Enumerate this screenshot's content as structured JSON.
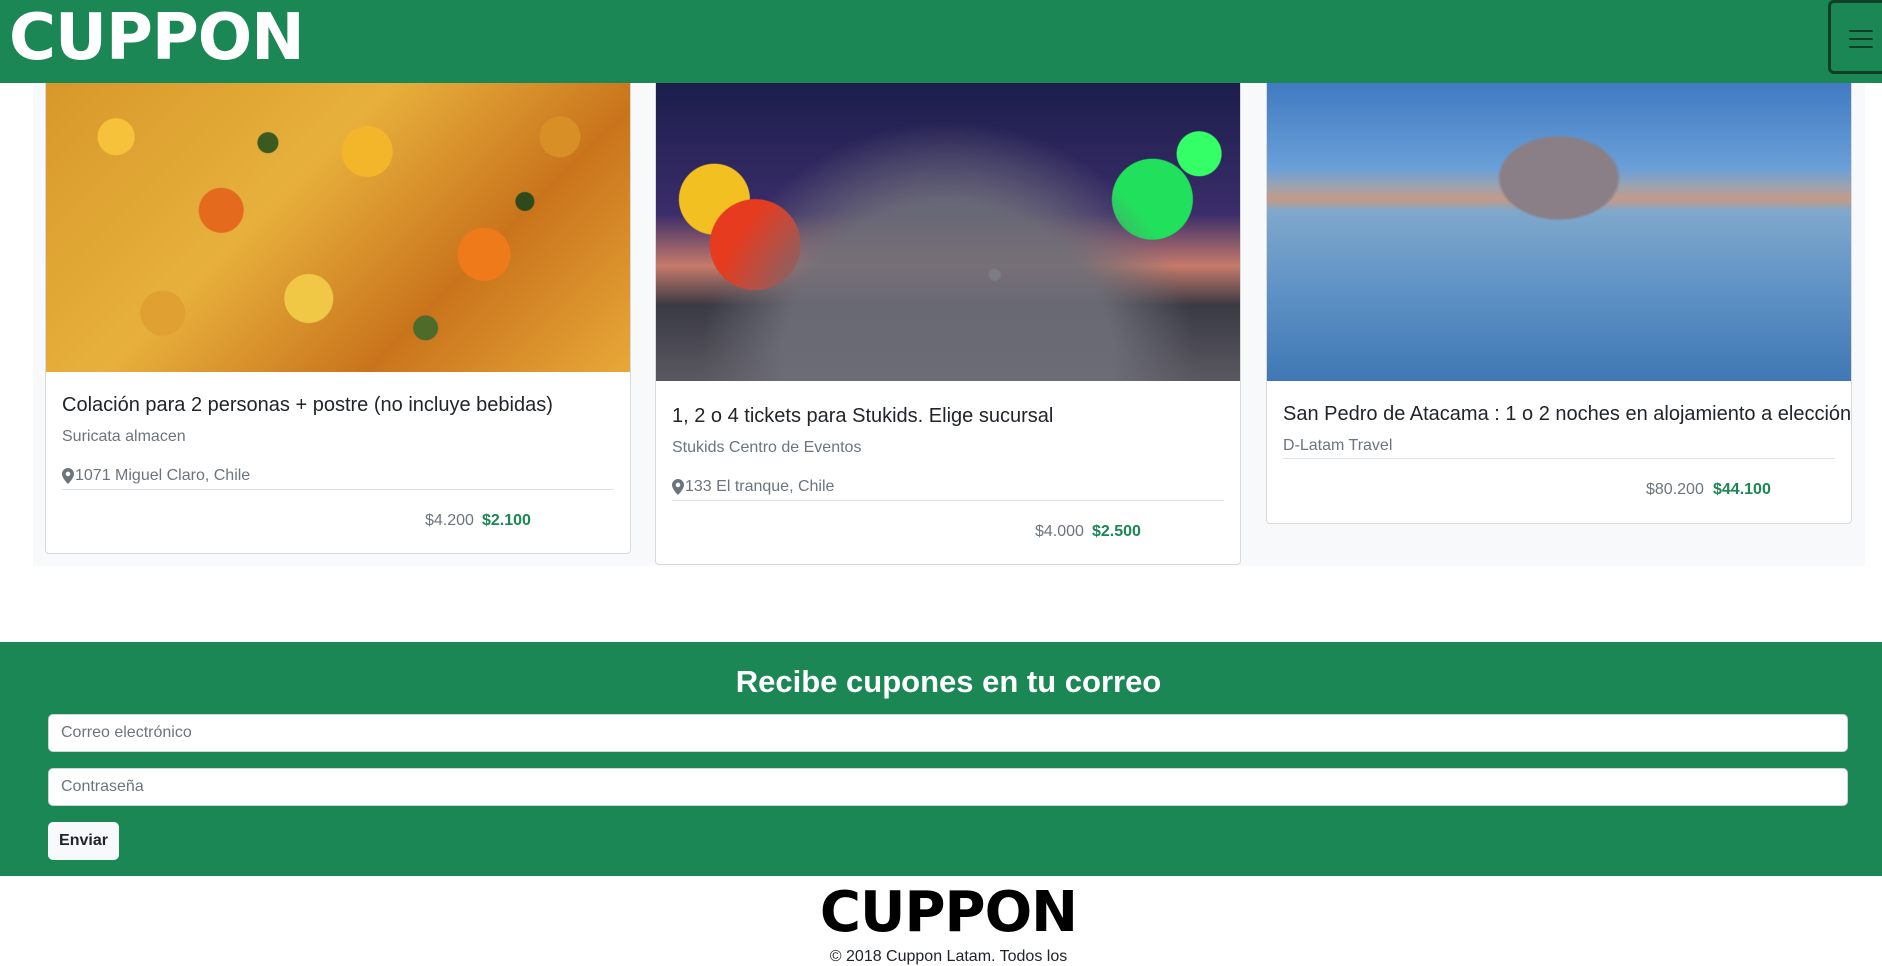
{
  "header": {
    "brand": "CUPPON",
    "menu_icon": "hamburger-menu-icon",
    "color": "#1a8754"
  },
  "deals": [
    {
      "image": "food-dish-photo",
      "title": "Colación para 2 personas + postre (no incluye bebidas)",
      "store": "Suricata almacen",
      "address": "1071 Miguel Claro, Chile",
      "price_old": "$4.200",
      "price_new": "$2.100"
    },
    {
      "image": "amusement-fair-photo",
      "title": "1, 2 o 4 tickets para Stukids. Elige sucursal",
      "store": "Stukids Centro de Eventos",
      "address": "133 El tranque, Chile",
      "price_old": "$4.000",
      "price_new": "$2.500"
    },
    {
      "image": "flamingo-lake-photo",
      "title": "San Pedro de Atacama : 1 o 2 noches en alojamiento a elección",
      "store": "D-Latam Travel",
      "price_old": "$80.200",
      "price_new": "$44.100"
    }
  ],
  "newsletter": {
    "title": "Recibe cupones en tu correo",
    "email_placeholder": "Correo electrónico",
    "password_placeholder": "Contraseña",
    "submit_label": "Enviar"
  },
  "footer": {
    "brand": "CUPPON",
    "copyright": "© 2018 Cuppon Latam. Todos los"
  }
}
